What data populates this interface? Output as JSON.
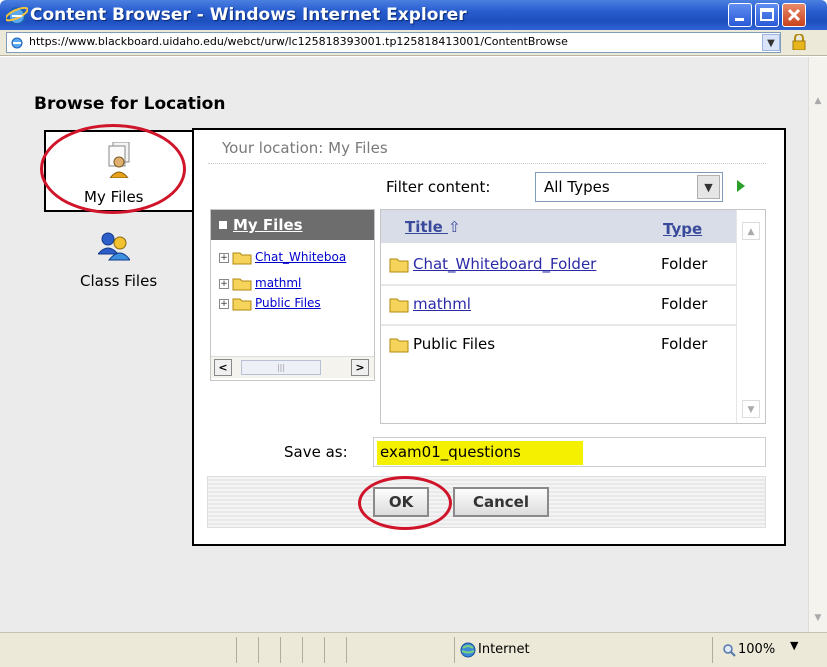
{
  "window": {
    "title": "Content Browser - Windows Internet Explorer",
    "controls": [
      "minimize-icon",
      "maximize-icon",
      "close-icon"
    ]
  },
  "address_bar": {
    "url": "https://www.blackboard.uidaho.edu/webct/urw/lc125818393001.tp125818413001/ContentBrowse"
  },
  "page": {
    "heading": "Browse for Location",
    "tabs": [
      {
        "label": "My Files",
        "icon": "my-files-icon",
        "selected": true
      },
      {
        "label": "Class Files",
        "icon": "class-files-icon",
        "selected": false
      }
    ],
    "location": "Your location: My Files",
    "filter": {
      "label": "Filter content:",
      "value": "All Types"
    },
    "tree": {
      "root": "My Files",
      "items": [
        "Chat_Whiteboa",
        "mathml",
        "Public Files"
      ]
    },
    "files": {
      "columns": {
        "title": "Title",
        "type": "Type"
      },
      "rows": [
        {
          "name": "Chat_Whiteboard_Folder",
          "type": "Folder",
          "link": true
        },
        {
          "name": "mathml",
          "type": "Folder",
          "link": true
        },
        {
          "name": "Public Files",
          "type": "Folder",
          "link": false
        }
      ]
    },
    "save_as": {
      "label": "Save as:",
      "value": "exam01_questions"
    },
    "buttons": {
      "ok": "OK",
      "cancel": "Cancel"
    }
  },
  "status_bar": {
    "zone": "Internet",
    "zoom": "100%"
  },
  "colors": {
    "titlebar": "#2a5fd0",
    "annotation": "#d0142a",
    "highlight": "#f5f000"
  }
}
